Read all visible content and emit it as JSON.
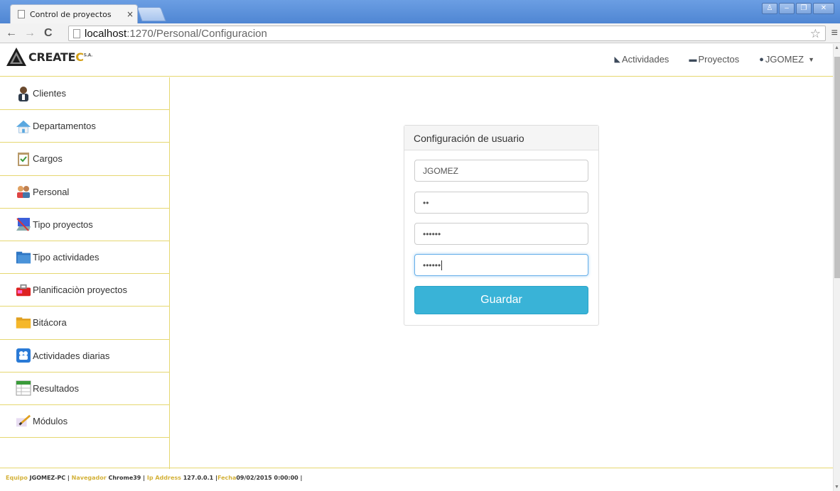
{
  "browser": {
    "tab_title": "Control de proyectos",
    "tab_close": "×",
    "url_host": "localhost",
    "url_path": ":1270/Personal/Configuracion"
  },
  "navbar": {
    "logo_main": "CREATE",
    "logo_accent": "C",
    "logo_suffix": "S.A.",
    "links": [
      {
        "label": "Actividades",
        "icon": "tag-icon"
      },
      {
        "label": "Proyectos",
        "icon": "folder-icon"
      },
      {
        "label": "JGOMEZ",
        "icon": "user-icon"
      }
    ]
  },
  "sidebar": {
    "items": [
      {
        "label": "Clientes",
        "icon": "client-icon"
      },
      {
        "label": "Departamentos",
        "icon": "home-icon"
      },
      {
        "label": "Cargos",
        "icon": "clipboard-icon"
      },
      {
        "label": "Personal",
        "icon": "people-icon"
      },
      {
        "label": "Tipo proyectos",
        "icon": "computer-icon"
      },
      {
        "label": "Tipo actividades",
        "icon": "folder-blue-icon"
      },
      {
        "label": "Planificaciòn proyectos",
        "icon": "toolbox-icon"
      },
      {
        "label": "Bitácora",
        "icon": "folder-yellow-icon"
      },
      {
        "label": "Actividades diarias",
        "icon": "messenger-icon"
      },
      {
        "label": "Resultados",
        "icon": "spreadsheet-icon"
      },
      {
        "label": "Módulos",
        "icon": "pencil-icon"
      }
    ]
  },
  "form": {
    "heading": "Configuración de usuario",
    "username": "JGOMEZ",
    "password_current": "••",
    "password_new": "••••••",
    "password_confirm": "••••••",
    "submit_label": "Guardar"
  },
  "footer": {
    "equipo_label": "Equipo",
    "equipo_value": "JGOMEZ-PC",
    "navegador_label": "Navegador",
    "navegador_value": "Chrome39",
    "ip_label": "Ip Address",
    "ip_value": "127.0.0.1",
    "fecha_label": "Fecha",
    "fecha_value": "09/02/2015 0:00:00"
  },
  "colors": {
    "accent_border": "#e6d770",
    "button": "#39b3d7",
    "footer_label": "#d4b23a"
  }
}
